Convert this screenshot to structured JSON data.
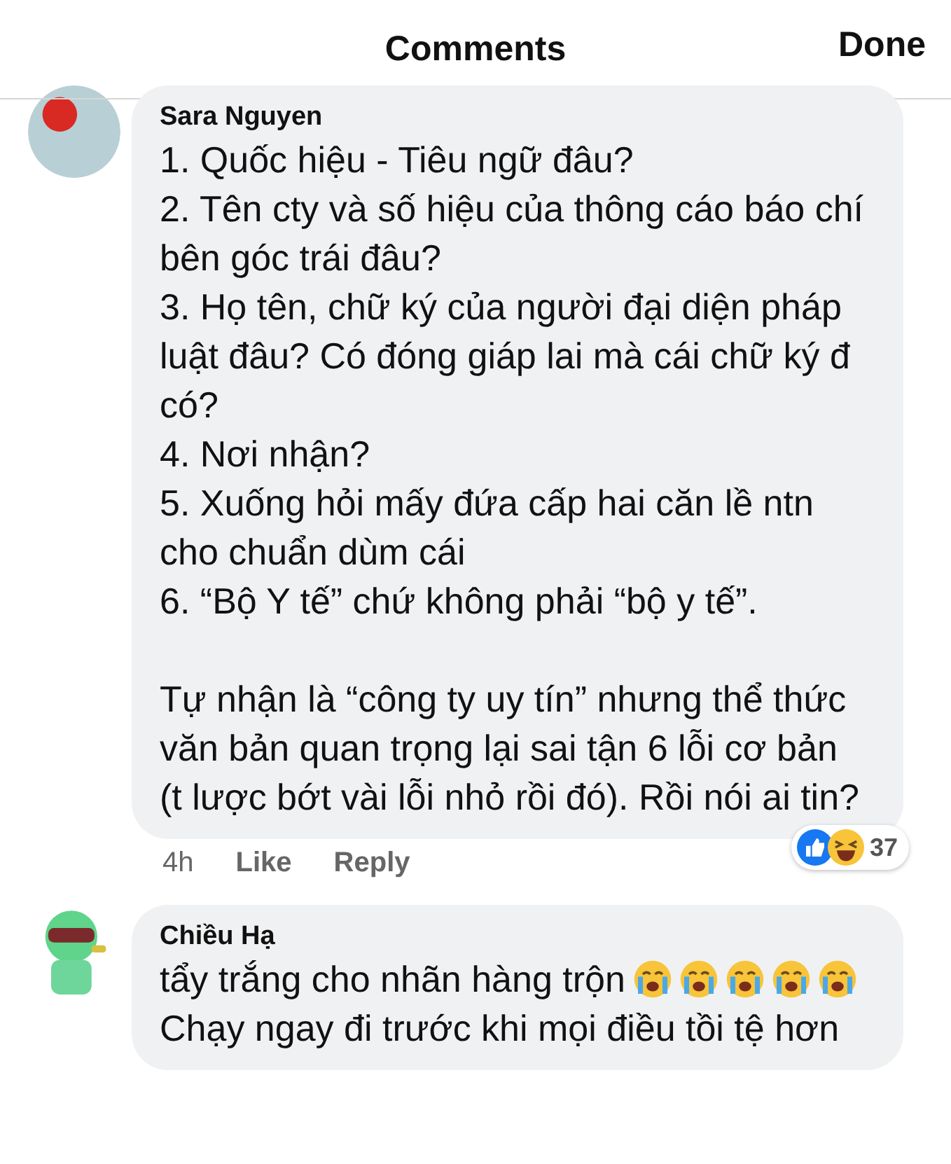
{
  "header": {
    "title": "Comments",
    "done": "Done"
  },
  "comments": [
    {
      "author": "Sara Nguyen",
      "avatar": {
        "kind": "photo"
      },
      "paragraphs": [
        [
          {
            "kind": "text",
            "text": "1. Quốc hiệu - Tiêu ngữ đâu?"
          }
        ],
        [
          {
            "kind": "text",
            "text": "2. Tên cty và số hiệu của thông cáo báo chí bên góc trái đâu?"
          }
        ],
        [
          {
            "kind": "text",
            "text": "3. Họ tên, chữ ký của người đại diện pháp luật đâu? Có đóng giáp lai mà cái chữ ký đ có?"
          }
        ],
        [
          {
            "kind": "text",
            "text": "4. Nơi nhận?"
          }
        ],
        [
          {
            "kind": "text",
            "text": "5. Xuống hỏi mấy đứa cấp hai căn lề ntn cho chuẩn dùm cái"
          }
        ],
        [
          {
            "kind": "text",
            "text": "6. “Bộ Y tế” chứ không phải “bộ y tế”."
          }
        ],
        [
          {
            "kind": "gap"
          }
        ],
        [
          {
            "kind": "text",
            "text": "Tự nhận là “công ty uy tín” nhưng thể thức văn bản quan trọng lại sai tận 6 lỗi cơ bản (t lược bớt vài lỗi nhỏ rồi đó). Rồi nói ai tin?"
          }
        ]
      ],
      "time": "4h",
      "like": "Like",
      "reply": "Reply",
      "reactions": {
        "count": "37"
      }
    },
    {
      "author": "Chiều Hạ",
      "avatar": {
        "kind": "cartoon"
      },
      "paragraphs": [
        [
          {
            "kind": "text",
            "text": "tẩy trắng cho nhãn hàng trộn"
          },
          {
            "kind": "crying"
          },
          {
            "kind": "crying"
          },
          {
            "kind": "crying"
          },
          {
            "kind": "crying"
          },
          {
            "kind": "crying"
          },
          {
            "kind": "text",
            "text": "Chạy ngay đi trước khi mọi điều tồi tệ hơn"
          }
        ]
      ]
    }
  ]
}
